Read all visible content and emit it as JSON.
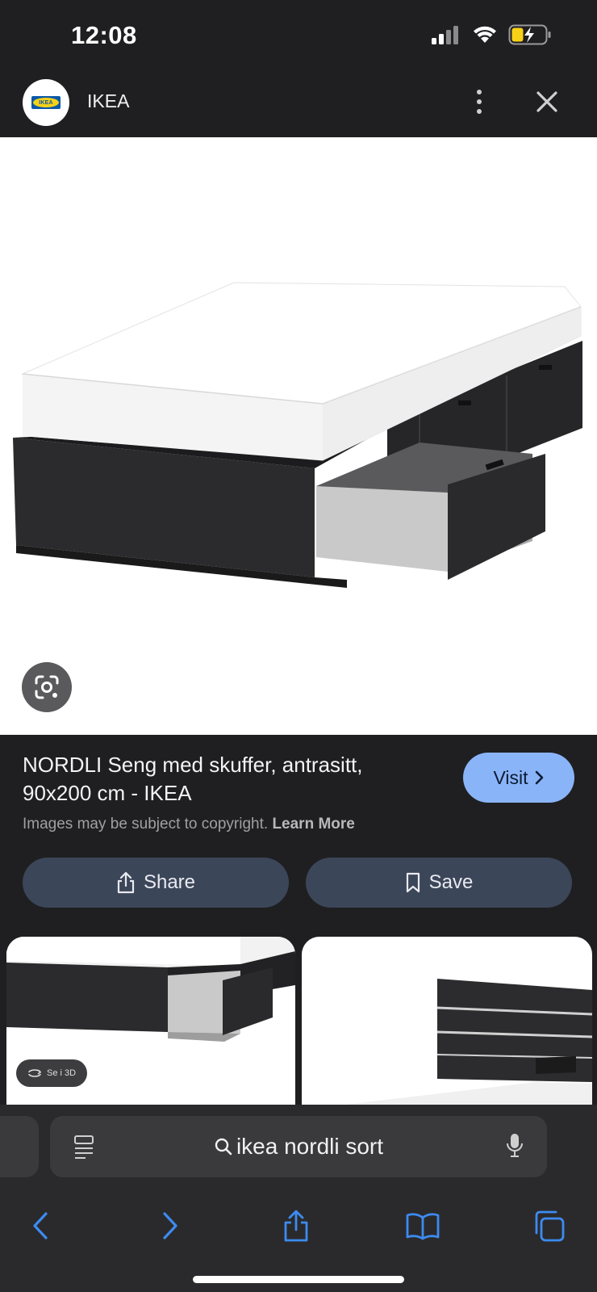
{
  "status_bar": {
    "time": "12:08"
  },
  "header": {
    "site_name": "IKEA",
    "logo_text": "IKEA"
  },
  "result": {
    "title_line1": "NORDLI Seng med skuffer, antrasitt,",
    "title_line2": "90x200 cm - IKEA",
    "visit_label": "Visit",
    "copyright_text": "Images may be subject to copyright.",
    "learn_more_label": "Learn More",
    "share_label": "Share",
    "save_label": "Save"
  },
  "thumbnails": [
    {
      "badge": "Se i 3D"
    },
    {
      "badge": ""
    }
  ],
  "address_bar": {
    "query": "ikea nordli sort"
  },
  "colors": {
    "accent": "#8ab4f8",
    "ios_blue": "#3d8bf0",
    "chip": "#3c4659",
    "battery": "#f7d117"
  },
  "icons": [
    "signal-icon",
    "wifi-icon",
    "battery-icon",
    "more-icon",
    "close-icon",
    "lens-icon",
    "share-icon",
    "bookmark-icon",
    "reader-icon",
    "search-icon",
    "mic-icon",
    "back-icon",
    "forward-icon",
    "share-sheet-icon",
    "bookmarks-icon",
    "tabs-icon"
  ]
}
